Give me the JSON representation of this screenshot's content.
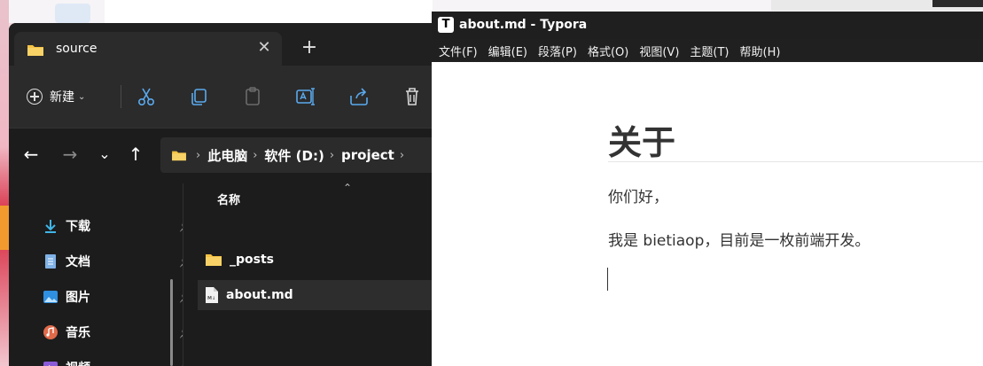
{
  "explorer": {
    "tab_title": "source",
    "tab_close": "✕",
    "new_tab": "+",
    "toolbar": {
      "new_label": "新建",
      "new_chevron": "⌄"
    },
    "nav_buttons": {
      "back": "←",
      "forward": "→",
      "recent": "⌄",
      "up": "↑"
    },
    "breadcrumb": [
      {
        "label": "此电脑"
      },
      {
        "label": "软件 (D:)"
      },
      {
        "label": "project"
      }
    ],
    "breadcrumb_sep": "›",
    "sidebar": [
      {
        "label": "下载",
        "icon": "download-icon",
        "color": "#3fb6e8"
      },
      {
        "label": "文档",
        "icon": "document-icon",
        "color": "#7fb2e6"
      },
      {
        "label": "图片",
        "icon": "pictures-icon",
        "color": "#2f8fe0"
      },
      {
        "label": "音乐",
        "icon": "music-icon",
        "color": "#e06a4a"
      },
      {
        "label": "视频",
        "icon": "video-icon",
        "color": "#8a5ad8"
      }
    ],
    "pin_glyph": "📌",
    "column_header": "名称",
    "sort_glyph": "⌃",
    "files": [
      {
        "name": "_posts",
        "type": "folder"
      },
      {
        "name": "about.md",
        "type": "markdown",
        "selected": true
      }
    ]
  },
  "typora": {
    "logo": "T",
    "title": "about.md - Typora",
    "menus": [
      "文件(F)",
      "编辑(E)",
      "段落(P)",
      "格式(O)",
      "视图(V)",
      "主题(T)",
      "帮助(H)"
    ],
    "heading": "关于",
    "paragraphs": [
      "你们好，",
      "我是 bietiaop，目前是一枚前端开发。"
    ]
  },
  "colors": {
    "folder": "#f5c244",
    "explorer_bg": "#1c1c1c",
    "typora_text": "#333333"
  }
}
